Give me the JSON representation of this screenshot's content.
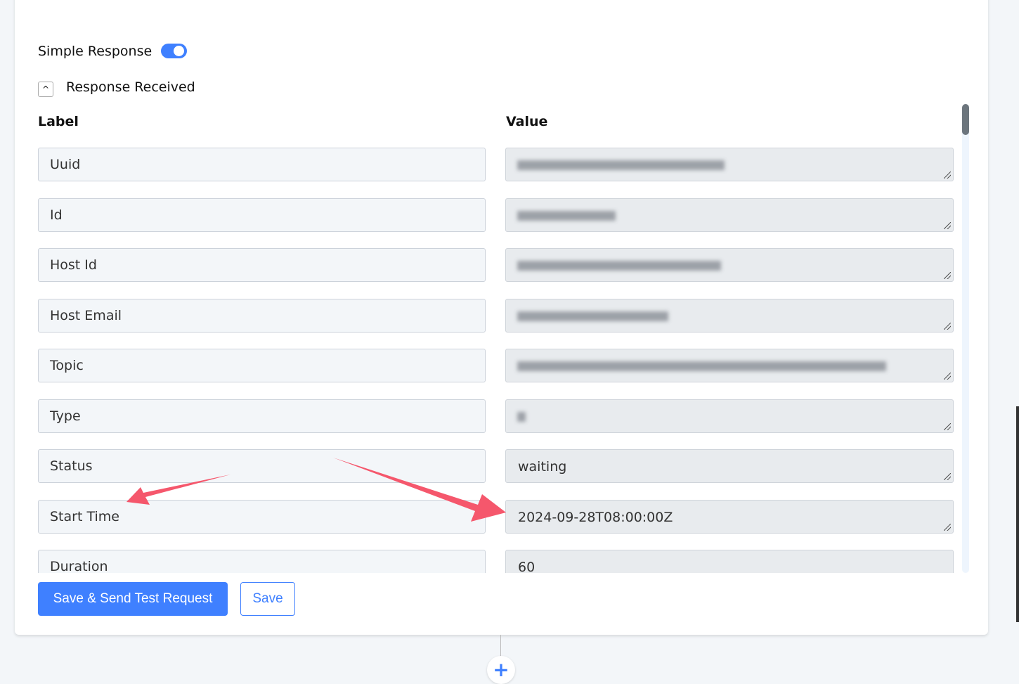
{
  "simple_response": {
    "label": "Simple Response",
    "enabled": true
  },
  "section": {
    "title": "Response Received",
    "expanded": true
  },
  "columns": {
    "label": "Label",
    "value": "Value"
  },
  "rows": [
    {
      "label": "Uuid",
      "value": "",
      "blurred": true
    },
    {
      "label": "Id",
      "value": "",
      "blurred": true
    },
    {
      "label": "Host Id",
      "value": "",
      "blurred": true
    },
    {
      "label": "Host Email",
      "value": "",
      "blurred": true
    },
    {
      "label": "Topic",
      "value": "",
      "blurred": true
    },
    {
      "label": "Type",
      "value": "",
      "blurred": true
    },
    {
      "label": "Status",
      "value": "waiting"
    },
    {
      "label": "Start Time",
      "value": "2024-09-28T08:00:00Z"
    },
    {
      "label": "Duration",
      "value": "60"
    }
  ],
  "buttons": {
    "save_send": "Save & Send Test Request",
    "save": "Save"
  },
  "add_step_icon": "plus-icon",
  "colors": {
    "accent": "#3f80ff",
    "annotation_arrow": "#f5576c"
  }
}
